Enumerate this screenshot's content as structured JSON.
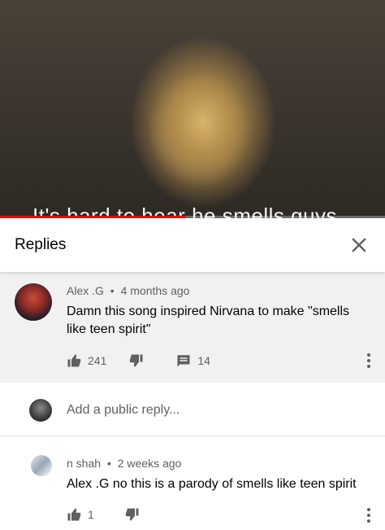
{
  "video": {
    "subtitle": "It's hard to hear he smells guys",
    "progress_fraction": 0.48
  },
  "panel": {
    "title": "Replies",
    "close_icon": "close-icon"
  },
  "parent_comment": {
    "author": "Alex .G",
    "separator": "•",
    "time": "4 months ago",
    "text": "Damn this song inspired Nirvana to make \"smells like teen spirit\"",
    "likes": "241",
    "replies": "14"
  },
  "reply_input": {
    "placeholder": "Add a public reply..."
  },
  "replies": [
    {
      "author": "n shah",
      "separator": "•",
      "time": "2 weeks ago",
      "text": "Alex .G no this is a parody of smells like teen spirit",
      "likes": "1"
    }
  ],
  "colors": {
    "accent": "#ff0000",
    "secondary_text": "#606060",
    "parent_bg": "#f1f1f1"
  }
}
